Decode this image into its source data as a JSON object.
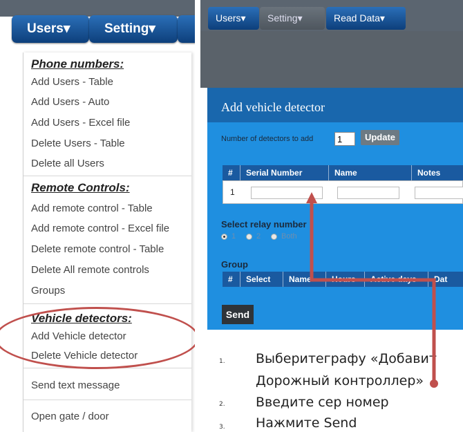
{
  "left": {
    "nav": {
      "users": "Users▾",
      "setting": "Setting▾"
    },
    "menu": {
      "phone_header": "Phone numbers:",
      "phone_items": [
        "Add Users - Table",
        "Add Users - Auto",
        "Add Users - Excel file",
        "Delete Users - Table",
        "Delete all Users"
      ],
      "remote_header": "Remote Controls:",
      "remote_items": [
        "Add remote control - Table",
        "Add remote control - Excel file",
        "Delete remote control - Table",
        "Delete All remote controls",
        "Groups"
      ],
      "vehicle_header": "Vehicle detectors:",
      "vehicle_items": [
        "Add Vehicle detector",
        "Delete Vehicle detector"
      ],
      "send_text": "Send text message",
      "open_gate": "Open gate / door"
    }
  },
  "right": {
    "nav": {
      "users": "Users▾",
      "setting": "Setting▾",
      "read_data": "Read Data▾"
    },
    "dialog": {
      "title": "Add vehicle detector",
      "num_label": "Number of detectors to add",
      "num_value": "1",
      "update": "Update",
      "table_headers": [
        "#",
        "Serial Number",
        "Name",
        "Notes"
      ],
      "row_number": "1",
      "relay_label": "Select relay number",
      "relay_options": [
        "1",
        "2",
        "Both"
      ],
      "group_label": "Group",
      "group_headers": [
        "#",
        "Select",
        "Name",
        "Hours",
        "Active days",
        "Dat"
      ],
      "send": "Send"
    },
    "instructions": [
      {
        "num": "1.",
        "text": "Выберитеграфу «Добавит",
        "text2": "Дорожный контроллер»"
      },
      {
        "num": "2.",
        "text": "Введите сер номер"
      },
      {
        "num": "3.",
        "text": " Нажмите Send"
      }
    ]
  },
  "colors": {
    "nav_blue": "#0d3f7b",
    "dialog_blue": "#1f8fe0",
    "highlight": "#b9d2ea",
    "annotation_red": "#c0504d"
  }
}
